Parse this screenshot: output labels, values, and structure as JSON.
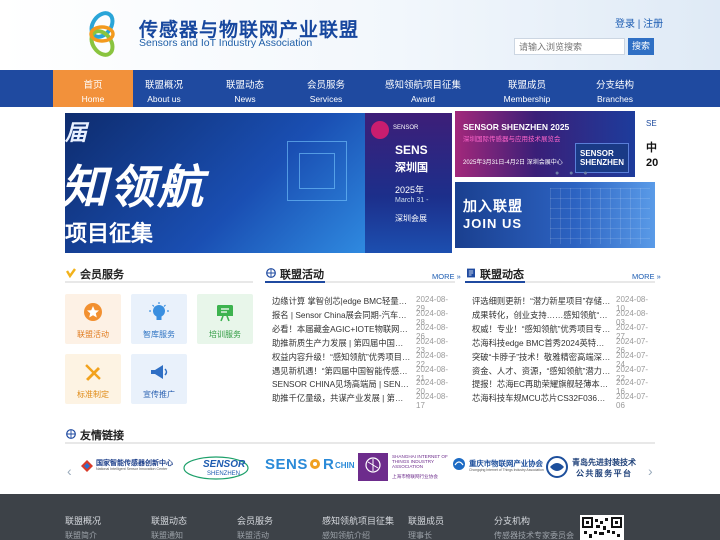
{
  "header": {
    "site_name": "传感器与物联网产业联盟",
    "site_name_en": "Sensors and IoT Industry Association",
    "login": "登录",
    "separator": "|",
    "register": "注册",
    "search_placeholder": "请输入浏览搜索",
    "search_button": "搜索"
  },
  "nav": [
    {
      "cn": "首页",
      "en": "Home"
    },
    {
      "cn": "联盟概况",
      "en": "About us"
    },
    {
      "cn": "联盟动态",
      "en": "News"
    },
    {
      "cn": "会员服务",
      "en": "Services"
    },
    {
      "cn": "感知领航项目征集",
      "en": "Award"
    },
    {
      "cn": "联盟成员",
      "en": "Membership"
    },
    {
      "cn": "分支结构",
      "en": "Branches"
    }
  ],
  "banner": {
    "top": "届",
    "big": "知领航",
    "sub": "项目征集"
  },
  "banner2": {
    "brand": "SENSOR",
    "title": "SENS",
    "city": "深圳国",
    "line": "2025年",
    "line2": "March 31 -",
    "line3": "深圳会展"
  },
  "promo": {
    "title": "SENSOR SHENZHEN 2025",
    "subtitle": "深圳国际传感器与应用技术展览会",
    "date": "2025年3月31日-4月2日 深圳会展中心",
    "badge": "SENSOR SHENZHEN",
    "dots": "● ● ●"
  },
  "promo_right": {
    "line1": "SE",
    "line2": "中",
    "line3": "20"
  },
  "join": {
    "cn": "加入联盟",
    "en": "JOIN US"
  },
  "member_services": {
    "title": "会员服务",
    "tiles": [
      {
        "label": "联盟活动"
      },
      {
        "label": "智库服务"
      },
      {
        "label": "培训服务"
      },
      {
        "label": "标准制定"
      },
      {
        "label": "宣传推广"
      }
    ]
  },
  "activities": {
    "title": "联盟活动",
    "more": "MORE »",
    "items": [
      {
        "title": "边缘计算 掌智创芯|edge BMC轻量级带外管",
        "date": "2024-08-29"
      },
      {
        "title": "报名 | Sensor China展会同期-汽车感知技术...",
        "date": "2024-08-28"
      },
      {
        "title": "必看！本届藏金AGIC+IOTE物联网展参观指...",
        "date": "2024-08-26"
      },
      {
        "title": "助推新质生产力发展 | 第四届中国智能传感大...",
        "date": "2024-08-23"
      },
      {
        "title": "权益内容升级！“感知领航”优秀项目福利来袭",
        "date": "2024-08-22"
      },
      {
        "title": "遇见新机遇！“第四届中国智能传感大会”...",
        "date": "2024-08-21"
      },
      {
        "title": "SENSOR CHINA见场高端局 | SENSOR TAL...",
        "date": "2024-08-20"
      },
      {
        "title": "助推千亿量级，共谋产业发展 | 第四届中国智...",
        "date": "2024-08-17"
      }
    ]
  },
  "news": {
    "title": "联盟动态",
    "more": "MORE »",
    "items": [
      {
        "title": "评选细则更新！“潜力新星项目”存储持续扩大",
        "date": "2024-08-10"
      },
      {
        "title": "成果转化，创业支持……感知领航“潜力新星项目”",
        "date": "2024-08-03"
      },
      {
        "title": "权威！专业！“感知领航”优秀项目专家评审公...",
        "date": "2024-07-27"
      },
      {
        "title": "芯海科技edge BMC首秀2024英特尔网络与边...",
        "date": "2024-07-26"
      },
      {
        "title": "突破“卡脖子”技术！敬雅精密高端深海MEMS...",
        "date": "2024-07-24"
      },
      {
        "title": "资金、人才、资源，“感知领航”潜力新星项目...",
        "date": "2024-07-22"
      },
      {
        "title": "提报！芯海EC再助荣耀旗舰轻薄本MagicBoo...",
        "date": "2024-07-16"
      },
      {
        "title": "芯海科技车规MCU芯片CS32F036Q荣获IAEI...",
        "date": "2024-07-06"
      }
    ]
  },
  "links": {
    "title": "友情链接",
    "partners": [
      {
        "name": "国家智能传感器创新中心",
        "sub": "National Intelligent Sensor Innovation Center"
      },
      {
        "name": "SENSOR",
        "sub": "SHENZHEN"
      },
      {
        "name": "SENS",
        "sub": "CHINA"
      },
      {
        "name": "SHANGHAI INTERNET OF THINGS INDUSTRY ASSOCIATION",
        "sub": "上海市物联网行业协会"
      },
      {
        "name": "重庆市物联网产业协会",
        "sub": "Chongqing Internet of Things Industry Association"
      },
      {
        "name": "青岛先进封装技术",
        "sub": "公共服务平台"
      }
    ],
    "prev": "‹",
    "next": "›"
  },
  "footer": {
    "columns": [
      {
        "title": "联盟概况",
        "sub": "联盟简介"
      },
      {
        "title": "联盟动态",
        "sub": "联盟通知"
      },
      {
        "title": "会员服务",
        "sub": "联盟活动"
      },
      {
        "title": "感知领航项目征集",
        "sub": "感知领航介绍"
      },
      {
        "title": "联盟成员",
        "sub": "理事长"
      },
      {
        "title": "分支机构",
        "sub": "传感器技术专家委员会"
      }
    ]
  },
  "colors": {
    "nav_bg": "#1f4aa0",
    "nav_active": "#f2913b",
    "brand_blue": "#17479e",
    "footer_bg": "#3d4248"
  }
}
